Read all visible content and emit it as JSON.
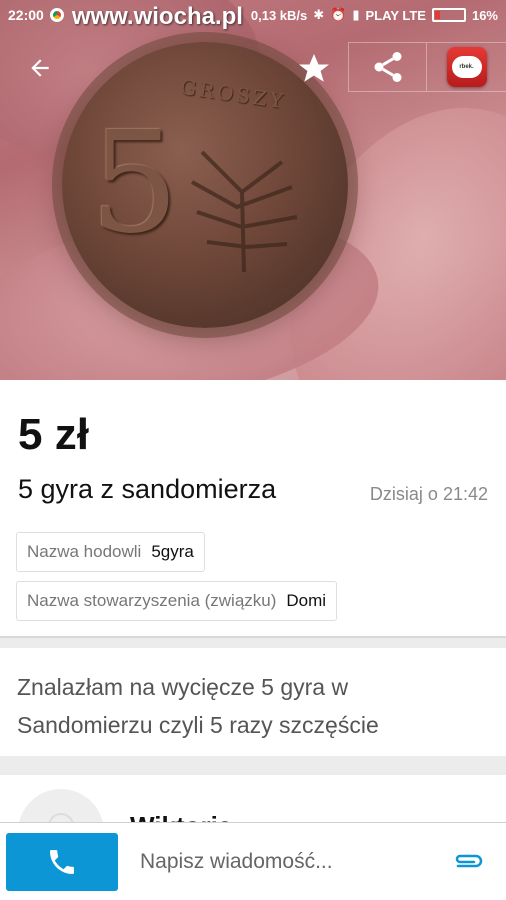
{
  "status_bar": {
    "time": "22:00",
    "watermark": "www.wiocha.pl",
    "speed": "0,13 kB/s",
    "carrier": "PLAY LTE",
    "battery": "16%",
    "battery_level": 0.16
  },
  "listing": {
    "price": "5 zł",
    "title": "5 gyra z sandomierza",
    "date": "Dzisiaj o 21:42",
    "params": [
      {
        "key": "Nazwa hodowli",
        "value": "5gyra"
      },
      {
        "key": "Nazwa stowarzyszenia (związku)",
        "value": "Domi"
      }
    ],
    "description": "Znalazłam na wycięcze 5 gyra w Sandomierzu czyli 5 razy szczęście"
  },
  "coin": {
    "numeral": "5",
    "inscription": "GROSZY"
  },
  "seller": {
    "name": "Wiktoria"
  },
  "app_icon_text": "rbek.",
  "bottom_bar": {
    "message_placeholder": "Napisz wiadomość..."
  },
  "colors": {
    "accent": "#0c96d6",
    "battery_low": "#e53935"
  },
  "icons": {
    "back": "arrow-back-icon",
    "favorite": "star-icon",
    "share": "share-icon",
    "call": "phone-icon",
    "attach": "paperclip-icon"
  }
}
